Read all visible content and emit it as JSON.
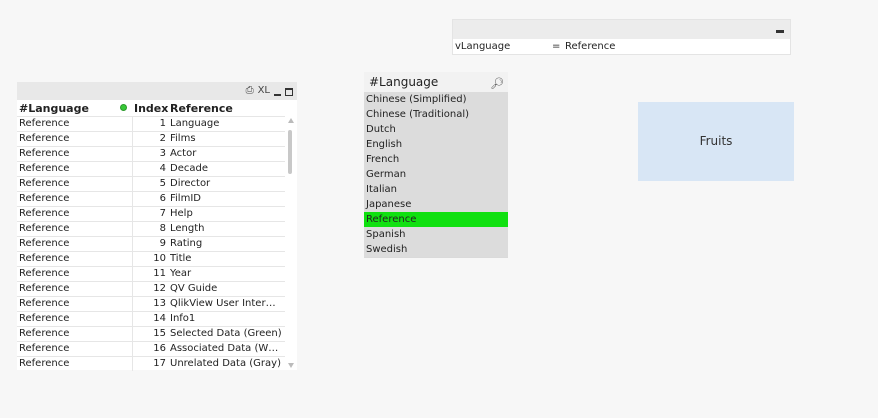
{
  "variable_box": {
    "name": "vLanguage",
    "equals": "=",
    "value": "Reference"
  },
  "table": {
    "headers": [
      "#Language",
      "Index",
      "Reference"
    ],
    "icons": [
      "print-icon",
      "excel-icon",
      "minimize-icon",
      "maximize-icon"
    ],
    "excel_label": "XL",
    "rows": [
      [
        "Reference",
        "1",
        "Language"
      ],
      [
        "Reference",
        "2",
        "Films"
      ],
      [
        "Reference",
        "3",
        "Actor"
      ],
      [
        "Reference",
        "4",
        "Decade"
      ],
      [
        "Reference",
        "5",
        "Director"
      ],
      [
        "Reference",
        "6",
        "FilmID"
      ],
      [
        "Reference",
        "7",
        "Help"
      ],
      [
        "Reference",
        "8",
        "Length"
      ],
      [
        "Reference",
        "9",
        "Rating"
      ],
      [
        "Reference",
        "10",
        "Title"
      ],
      [
        "Reference",
        "11",
        "Year"
      ],
      [
        "Reference",
        "12",
        "QV Guide"
      ],
      [
        "Reference",
        "13",
        "QlikView User Inter…"
      ],
      [
        "Reference",
        "14",
        "Info1"
      ],
      [
        "Reference",
        "15",
        "Selected Data (Green)"
      ],
      [
        "Reference",
        "16",
        "Associated Data (W…"
      ],
      [
        "Reference",
        "17",
        "Unrelated Data (Gray)"
      ]
    ]
  },
  "listbox": {
    "title": "#Language",
    "items": [
      "Chinese (Simplified)",
      "Chinese (Traditional)",
      "Dutch",
      "English",
      "French",
      "German",
      "Italian",
      "Japanese",
      "Reference",
      "Spanish",
      "Swedish"
    ],
    "selected": "Reference",
    "selected_color": "#10e010"
  },
  "fruits_button": {
    "label": "Fruits"
  }
}
